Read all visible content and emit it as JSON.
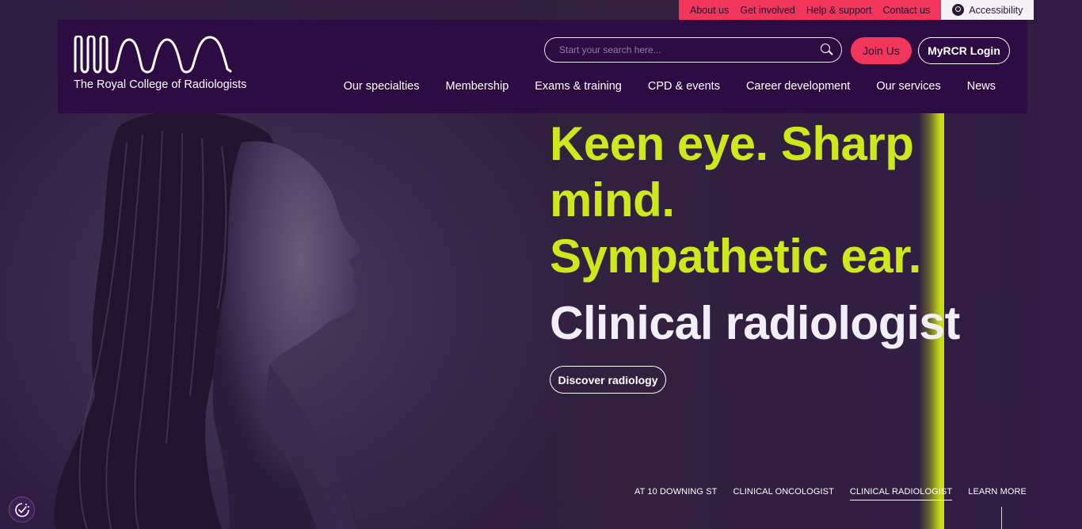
{
  "utility": {
    "links": [
      "About us",
      "Get involved",
      "Help & support",
      "Contact us"
    ],
    "accessibility": "Accessibility"
  },
  "header": {
    "logo_text": "The Royal College of Radiologists",
    "search_placeholder": "Start your search here...",
    "join_label": "Join Us",
    "login_label": "MyRCR Login",
    "nav": [
      "Our specialties",
      "Membership",
      "Exams & training",
      "CPD & events",
      "Career development",
      "Our services",
      "News"
    ]
  },
  "hero": {
    "headline": "Keen eye. Sharp mind. Sympathetic ear.",
    "subhead": "Clinical radiologist",
    "cta": "Discover radiology"
  },
  "slides": {
    "items": [
      "AT 10 DOWNING ST",
      "CLINICAL ONCOLOGIST",
      "CLINICAL RADIOLOGIST",
      "LEARN MORE"
    ],
    "active": "CLINICAL RADIOLOGIST"
  },
  "colors": {
    "accent_pink": "#f2355b",
    "header_bg": "#2d0c44",
    "headline_lime": "#cde81b",
    "page_bg": "#2e1a3f"
  },
  "icons": [
    "accessibility-icon",
    "search-icon",
    "logo-wave-icon",
    "cookie-settings-icon"
  ]
}
